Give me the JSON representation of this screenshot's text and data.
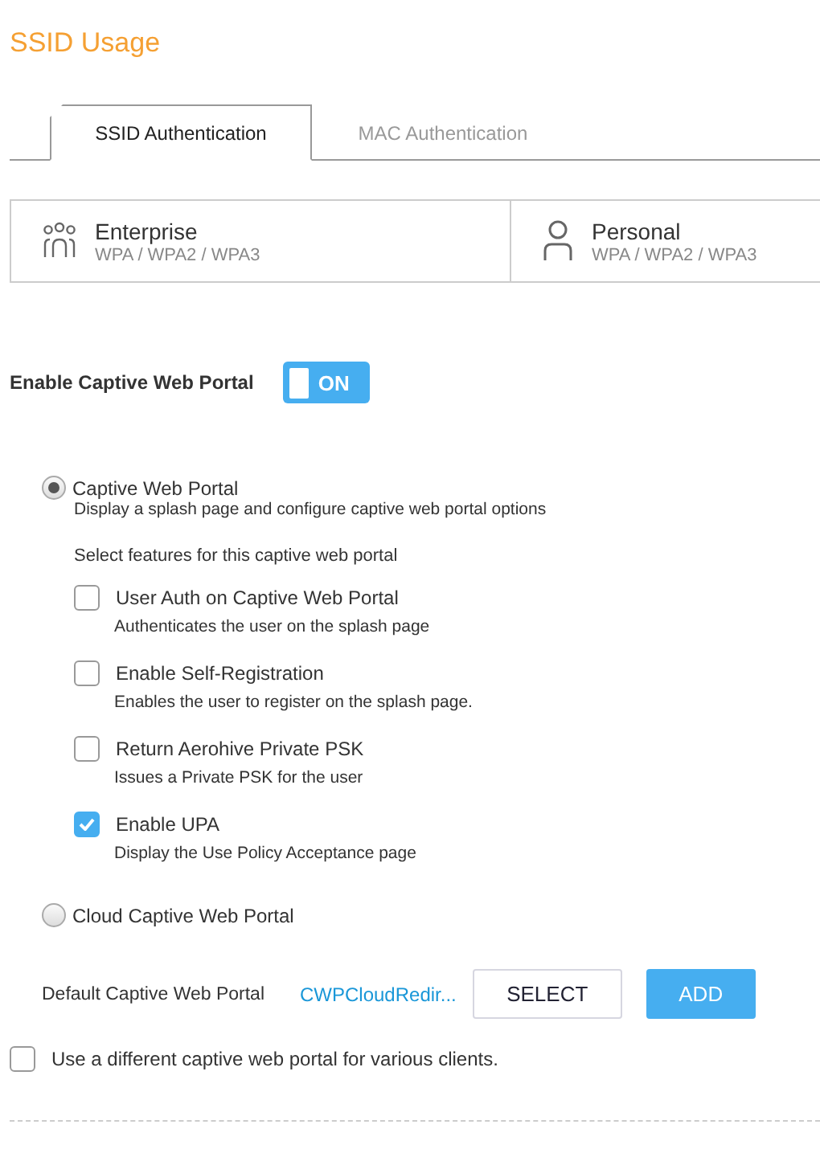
{
  "title": "SSID Usage",
  "tabs": [
    {
      "label": "SSID Authentication",
      "selected": true
    },
    {
      "label": "MAC Authentication",
      "selected": false
    }
  ],
  "security_types": [
    {
      "kind": "enterprise",
      "name": "Enterprise",
      "protocols": "WPA / WPA2 / WPA3"
    },
    {
      "kind": "personal",
      "name": "Personal",
      "protocols": "WPA / WPA2 / WPA3"
    }
  ],
  "captive_portal_toggle": {
    "label": "Enable Captive Web Portal",
    "on": true,
    "state_text": "ON"
  },
  "portal_options": [
    {
      "label": "Captive Web Portal",
      "description": "Display a splash page and configure captive web portal options",
      "selected": true,
      "features_heading": "Select features for this captive web portal",
      "features": [
        {
          "label": "User Auth on Captive Web Portal",
          "description": "Authenticates the user on the splash page",
          "checked": false
        },
        {
          "label": "Enable Self-Registration",
          "description": "Enables the user to register on the splash page.",
          "checked": false
        },
        {
          "label": "Return Aerohive Private PSK",
          "description": "Issues a Private PSK for the user",
          "checked": false
        },
        {
          "label": "Enable UPA",
          "description": "Display the Use Policy Acceptance page",
          "checked": true
        }
      ]
    },
    {
      "label": "Cloud Captive Web Portal",
      "selected": false
    }
  ],
  "default_portal": {
    "label": "Default Captive Web Portal",
    "value": "CWPCloudRedir...",
    "buttons": [
      {
        "kind": "secondary",
        "label": "SELECT"
      },
      {
        "kind": "primary",
        "label": "ADD"
      }
    ]
  },
  "different_portal": {
    "label": "Use a different captive web portal for various clients.",
    "checked": false
  }
}
